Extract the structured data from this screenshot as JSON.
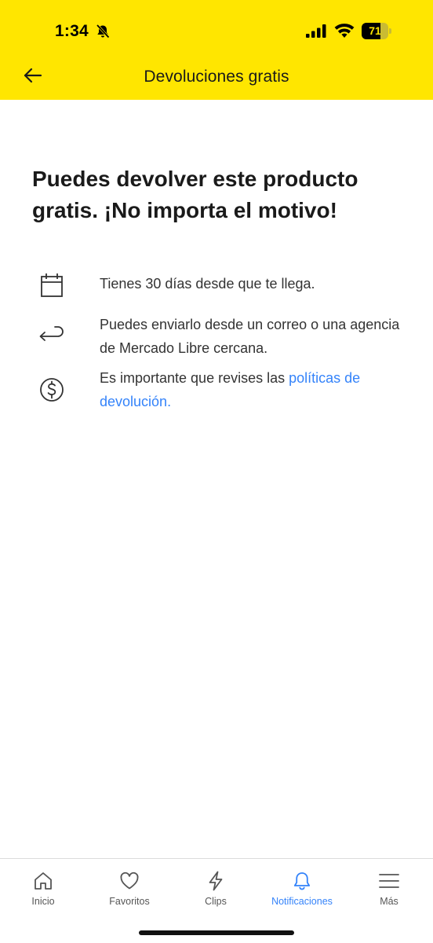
{
  "status_bar": {
    "time": "1:34",
    "battery_level": "71",
    "battery_fraction": 0.71
  },
  "header": {
    "title": "Devoluciones gratis",
    "back_icon": "arrow-left-icon"
  },
  "content": {
    "title": "Puedes devolver este producto gratis. ¡No importa el motivo!",
    "items": [
      {
        "icon": "calendar-icon",
        "text": "Tienes 30 días desde que te llega."
      },
      {
        "icon": "return-arrow-icon",
        "text": "Puedes enviarlo desde un correo o una agencia de Mercado Libre cercana."
      },
      {
        "icon": "dollar-circle-icon",
        "text": "Es importante que revises las ",
        "link_text": "políticas de devolución."
      }
    ]
  },
  "bottom_nav": {
    "items": [
      {
        "label": "Inicio",
        "icon": "home-icon"
      },
      {
        "label": "Favoritos",
        "icon": "heart-icon"
      },
      {
        "label": "Clips",
        "icon": "bolt-icon"
      },
      {
        "label": "Notificaciones",
        "icon": "bell-icon",
        "active": true
      },
      {
        "label": "Más",
        "icon": "menu-icon"
      }
    ]
  },
  "colors": {
    "brand_yellow": "#ffe600",
    "link_blue": "#3483fa",
    "text_dark": "#1a1a1a"
  }
}
